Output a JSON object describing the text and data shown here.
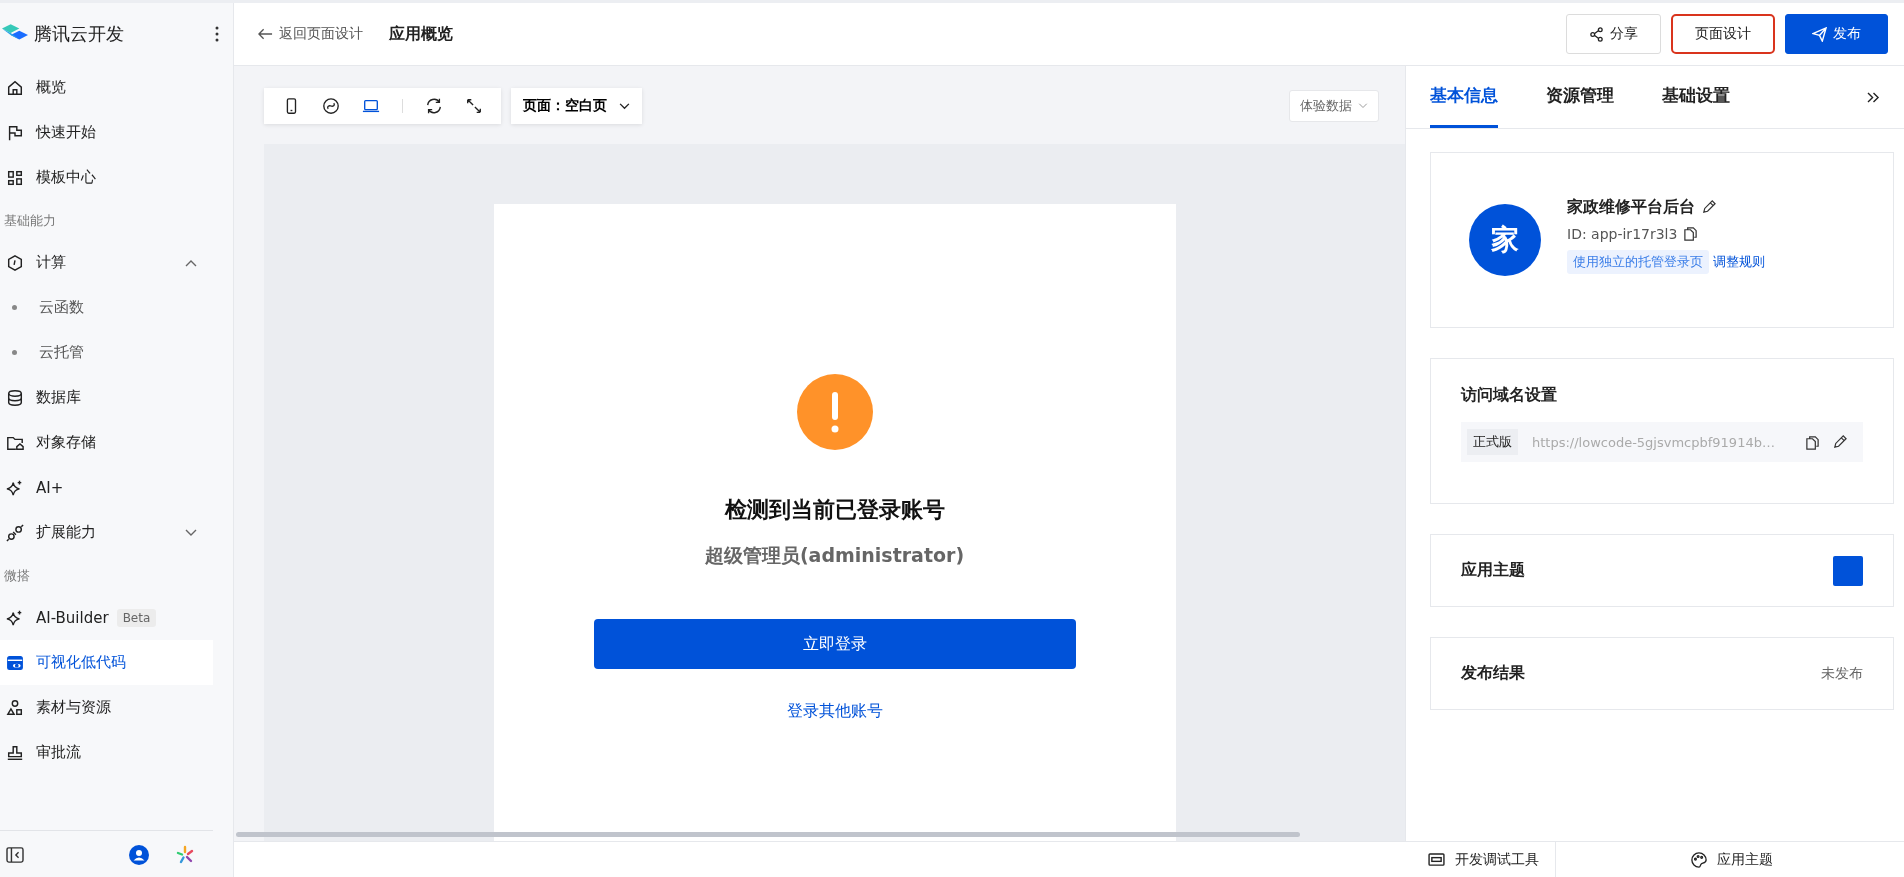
{
  "sidebar": {
    "brand": "腾讯云开发",
    "groups": [
      {
        "items": [
          {
            "label": "概览",
            "selected": false
          },
          {
            "label": "快速开始",
            "selected": false
          },
          {
            "label": "模板中心",
            "selected": false
          }
        ]
      },
      {
        "heading": "基础能力",
        "items": [
          {
            "label": "计算",
            "selected": false,
            "expanded": true,
            "children": [
              {
                "label": "云函数",
                "selected": false
              },
              {
                "label": "云托管",
                "selected": false
              }
            ]
          },
          {
            "label": "数据库",
            "selected": false
          },
          {
            "label": "对象存储",
            "selected": false
          },
          {
            "label": "AI+",
            "selected": false
          },
          {
            "label": "扩展能力",
            "selected": false,
            "expanded": false
          }
        ]
      },
      {
        "heading": "微搭",
        "items": [
          {
            "label": "AI-Builder",
            "selected": false,
            "badge": "Beta"
          },
          {
            "label": "可视化低代码",
            "selected": true
          },
          {
            "label": "素材与资源",
            "selected": false
          },
          {
            "label": "审批流",
            "selected": false
          }
        ]
      }
    ]
  },
  "topbar": {
    "back_link": "返回页面设计",
    "title": "应用概览",
    "buttons": [
      {
        "label": "分享",
        "kind": "share",
        "highlighted": false
      },
      {
        "label": "页面设计",
        "kind": "plain",
        "highlighted": true
      },
      {
        "label": "发布",
        "kind": "primary",
        "highlighted": false
      }
    ]
  },
  "toolbar": {
    "devices": [
      {
        "selected": false
      },
      {
        "selected": false
      },
      {
        "selected": true
      }
    ],
    "page_select": "页面：空白页",
    "data_select": "体验数据"
  },
  "preview": {
    "title": "检测到当前已登录账号",
    "subtitle": "超级管理员(administrator)",
    "button": "立即登录",
    "link": "登录其他账号"
  },
  "panel": {
    "tabs": [
      {
        "label": "基本信息",
        "selected": true
      },
      {
        "label": "资源管理",
        "selected": false
      },
      {
        "label": "基础设置",
        "selected": false
      }
    ],
    "app": {
      "avatar": "家",
      "name": "家政维修平台后台",
      "id": "ID: app-ir17r3l3",
      "tag": "使用独立的托管登录页",
      "link": "调整规则"
    },
    "domain": {
      "title": "访问域名设置",
      "version": "正式版",
      "url": "https://lowcode-5gjsvmcpbf91914b…"
    },
    "theme": {
      "title": "应用主题",
      "color": "#0052d9"
    },
    "publish": {
      "title": "发布结果",
      "status": "未发布"
    }
  },
  "bottom_bar": {
    "debug": "开发调试工具",
    "theme": "应用主题"
  }
}
